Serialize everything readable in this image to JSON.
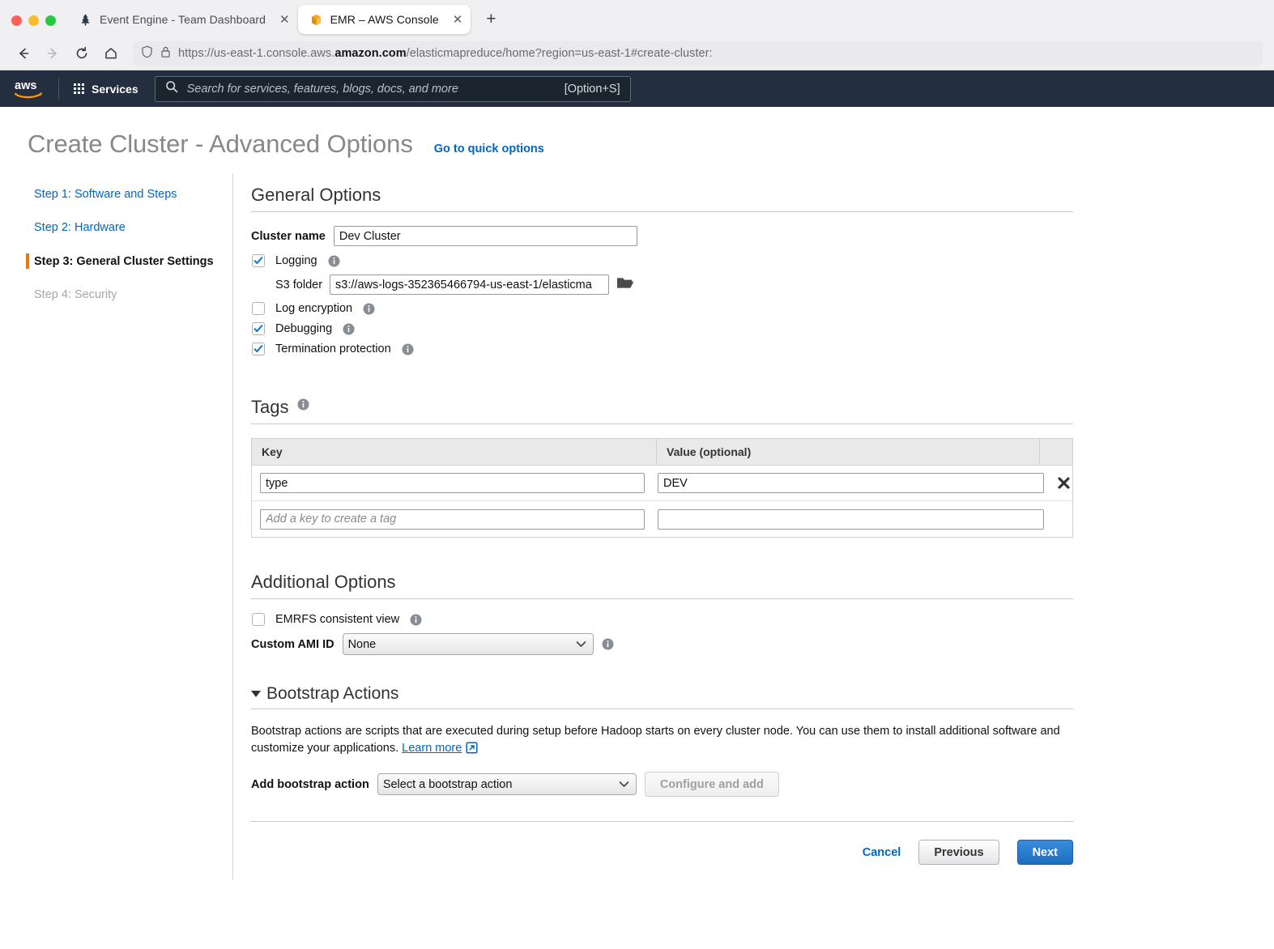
{
  "browser": {
    "tabs": [
      {
        "title": "Event Engine - Team Dashboard",
        "icon": "pine-tree-icon",
        "active": false,
        "close_label": "✕"
      },
      {
        "title": "EMR – AWS Console",
        "icon": "orange-cube-icon",
        "active": true,
        "close_label": "✕"
      }
    ],
    "new_tab_label": "+",
    "url_prefix": "https://us-east-1.console.aws.",
    "url_bold": "amazon.com",
    "url_suffix": "/elasticmapreduce/home?region=us-east-1#create-cluster:",
    "nav": {
      "back": "←",
      "forward": "→",
      "reload": "⟳",
      "home": "⌂"
    }
  },
  "aws_header": {
    "logo_text": "aws",
    "services_label": "Services",
    "search_placeholder": "Search for services, features, blogs, docs, and more",
    "search_shortcut": "[Option+S]",
    "bg_color": "#232f3e"
  },
  "page": {
    "title": "Create Cluster - Advanced Options",
    "quick_options_link": "Go to quick options",
    "accent_orange": "#e47911",
    "link_blue": "#0066c0"
  },
  "sidebar": {
    "steps": [
      {
        "label": "Step 1: Software and Steps",
        "state": "link"
      },
      {
        "label": "Step 2: Hardware",
        "state": "link"
      },
      {
        "label": "Step 3: General Cluster Settings",
        "state": "current"
      },
      {
        "label": "Step 4: Security",
        "state": "disabled"
      }
    ]
  },
  "general_options": {
    "heading": "General Options",
    "cluster_name_label": "Cluster name",
    "cluster_name_value": "Dev Cluster",
    "logging_label": "Logging",
    "logging_checked": true,
    "s3_folder_label": "S3 folder",
    "s3_folder_value": "s3://aws-logs-352365466794-us-east-1/elasticma",
    "browse_icon": "folder-open-icon",
    "log_encryption_label": "Log encryption",
    "log_encryption_checked": false,
    "debugging_label": "Debugging",
    "debugging_checked": true,
    "termination_protection_label": "Termination protection",
    "termination_protection_checked": true
  },
  "tags": {
    "heading": "Tags",
    "columns": [
      "Key",
      "Value (optional)",
      ""
    ],
    "rows": [
      {
        "key": "type",
        "value": "DEV",
        "key_placeholder": "",
        "value_placeholder": "",
        "deletable": true
      },
      {
        "key": "",
        "value": "",
        "key_placeholder": "Add a key to create a tag",
        "value_placeholder": "",
        "deletable": false
      }
    ],
    "delete_icon": "close-x-icon"
  },
  "additional_options": {
    "heading": "Additional Options",
    "emrfs_label": "EMRFS consistent view",
    "emrfs_checked": false,
    "custom_ami_label": "Custom AMI ID",
    "custom_ami_value": "None",
    "custom_ami_options": [
      "None"
    ]
  },
  "bootstrap": {
    "heading": "Bootstrap Actions",
    "description_part1": "Bootstrap actions are scripts that are executed during setup before Hadoop starts on every cluster node. You can use them to install additional software and customize your applications. ",
    "learn_more": "Learn more",
    "external_icon": "external-link-icon",
    "add_label": "Add bootstrap action",
    "select_value": "Select a bootstrap action",
    "select_options": [
      "Select a bootstrap action"
    ],
    "configure_button": "Configure and add",
    "configure_disabled": true
  },
  "footer": {
    "cancel": "Cancel",
    "previous": "Previous",
    "next": "Next"
  }
}
